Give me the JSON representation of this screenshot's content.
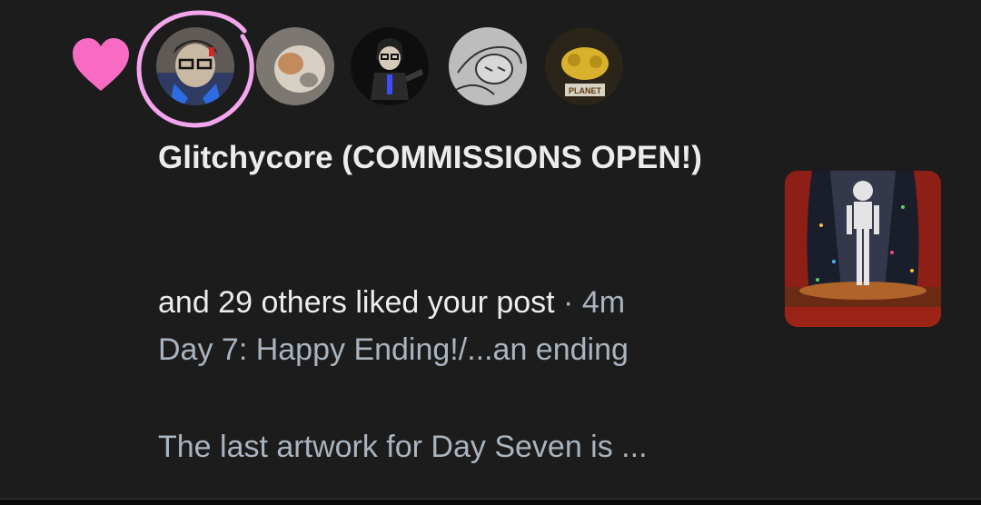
{
  "notification": {
    "type_icon": "heart-icon",
    "liker_name": "Glitchycore (COMMISSIONS OPEN!)",
    "action_text": "and 29 others liked your post",
    "separator": " · ",
    "time_ago": "4m",
    "post_title": "Day 7: Happy Ending!/...an ending",
    "post_snippet": "The last artwork for Day Seven is ...",
    "thumbnail_caption": "PLANET",
    "avatars": [
      {
        "name": "avatar-glitchycore",
        "highlighted": true
      },
      {
        "name": "avatar-liker-2",
        "highlighted": false
      },
      {
        "name": "avatar-liker-3",
        "highlighted": false
      },
      {
        "name": "avatar-liker-4",
        "highlighted": false
      },
      {
        "name": "avatar-liker-5",
        "highlighted": false
      }
    ]
  },
  "colors": {
    "background": "#1c1c1c",
    "heart": "#f76bc3",
    "highlight_ring": "#f3a6ee",
    "primary_text": "#ececec",
    "secondary_text": "#a9b4bf"
  }
}
